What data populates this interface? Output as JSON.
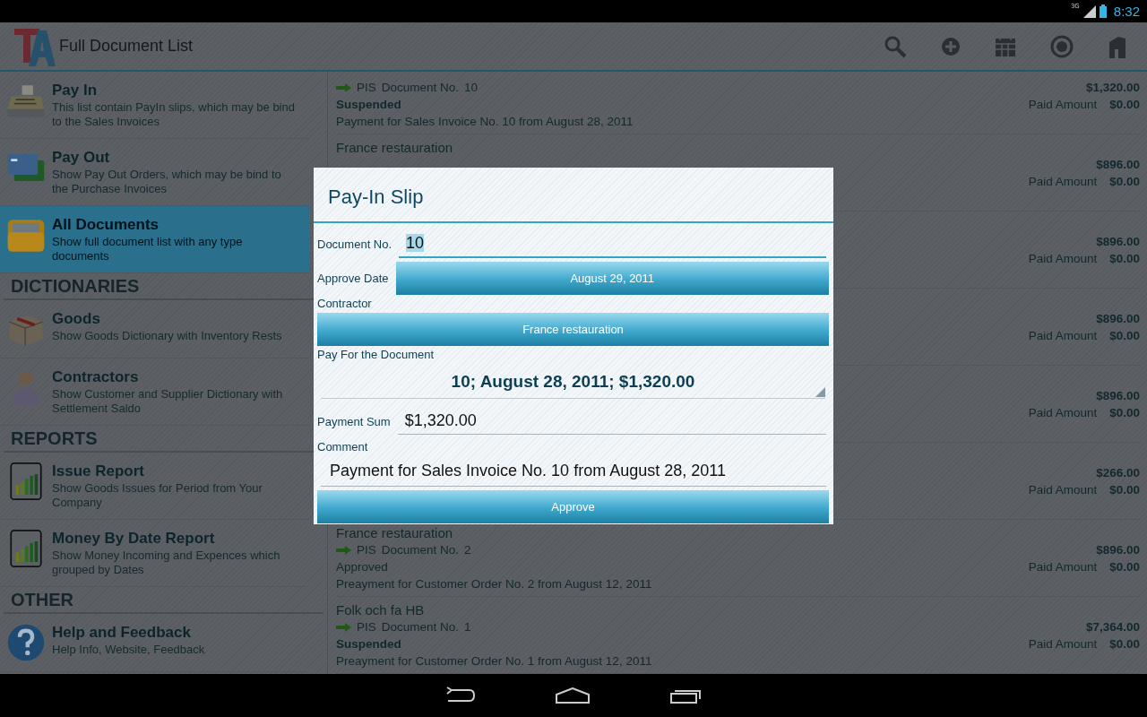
{
  "status_bar": {
    "network": "3G",
    "time": "8:32"
  },
  "action_bar": {
    "title": "Full Document List"
  },
  "sidebar": {
    "items": [
      {
        "kind": "item",
        "title": "Pay In",
        "description": "This list contain PayIn slips, which may be bind to the Sales Invoices",
        "selected": false
      },
      {
        "kind": "item",
        "title": "Pay Out",
        "description": "Show Pay Out Orders, which may be bind to the Purchase Invoices",
        "selected": false
      },
      {
        "kind": "item",
        "title": "All Documents",
        "description": "Show full document list with any type documents",
        "selected": true
      },
      {
        "kind": "header",
        "title": "DICTIONARIES"
      },
      {
        "kind": "item",
        "title": "Goods",
        "description": "Show Goods Dictionary with Inventory Rests",
        "selected": false
      },
      {
        "kind": "item",
        "title": "Contractors",
        "description": "Show Customer and Supplier Dictionary with Settlement Saldo",
        "selected": false
      },
      {
        "kind": "header",
        "title": "REPORTS"
      },
      {
        "kind": "item",
        "title": "Issue Report",
        "description": "Show Goods Issues for Period from Your Company",
        "selected": false
      },
      {
        "kind": "item",
        "title": "Money By Date Report",
        "description": "Show Money Incoming and Expences which grouped by Dates",
        "selected": false
      },
      {
        "kind": "header",
        "title": "OTHER"
      },
      {
        "kind": "item",
        "title": "Help and Feedback",
        "description": "Help Info, Website, Feedback",
        "selected": false
      }
    ]
  },
  "documents": {
    "rows": [
      {
        "doc_type": "PIS",
        "doc_label": "Document No.",
        "doc_no": "10",
        "status": "Suspended",
        "status_bold": true,
        "comment": "Payment for Sales Invoice No. 10 from August 28, 2011",
        "amount": "$1,320.00",
        "paid_label": "Paid Amount",
        "paid": "$0.00"
      },
      {
        "contractor": "France restauration",
        "amount": "$896.00",
        "paid_label": "Paid Amount",
        "paid": "$0.00"
      },
      {
        "amount": "$896.00",
        "paid_label": "Paid Amount",
        "paid": "$0.00"
      },
      {
        "amount": "$896.00",
        "paid_label": "Paid Amount",
        "paid": "$0.00"
      },
      {
        "amount": "$896.00",
        "paid_label": "Paid Amount",
        "paid": "$0.00"
      },
      {
        "amount": "$266.00",
        "paid_label": "Paid Amount",
        "paid": "$0.00"
      },
      {
        "contractor": "France restauration",
        "doc_type": "PIS",
        "doc_label": "Document No.",
        "doc_no": "2",
        "status": "Approved",
        "status_bold": false,
        "comment": "Preayment for Customer Order No. 2 from August 12, 2011",
        "amount": "$896.00",
        "paid_label": "Paid Amount",
        "paid": "$0.00"
      },
      {
        "contractor": "Folk och fa HB",
        "doc_type": "PIS",
        "doc_label": "Document No.",
        "doc_no": "1",
        "status": "Suspended",
        "status_bold": true,
        "comment": "Preayment for Customer Order No. 1 from August 12, 2011",
        "amount": "$7,364.00",
        "paid_label": "Paid Amount",
        "paid": "$0.00"
      }
    ]
  },
  "dialog": {
    "title": "Pay-In Slip",
    "fields": [
      {
        "kind": "inline_input",
        "label": "Document No.",
        "value": "10",
        "focused": true,
        "value_selected": true
      },
      {
        "kind": "inline_button",
        "label": "Approve Date",
        "value": "August 29, 2011"
      },
      {
        "kind": "block_button",
        "label": "Contractor",
        "value": "France restauration"
      },
      {
        "kind": "spinner",
        "label": "Pay For the Document",
        "value": "10; August 28, 2011; $1,320.00"
      },
      {
        "kind": "inline_input",
        "label": "Payment Sum",
        "value": "$1,320.00",
        "focused": false,
        "value_selected": false
      },
      {
        "kind": "block_input",
        "label": "Comment",
        "value": "Payment for Sales Invoice No. 10 from August 28, 2011",
        "focused": false,
        "value_selected": false
      }
    ],
    "approve_button": "Approve"
  }
}
